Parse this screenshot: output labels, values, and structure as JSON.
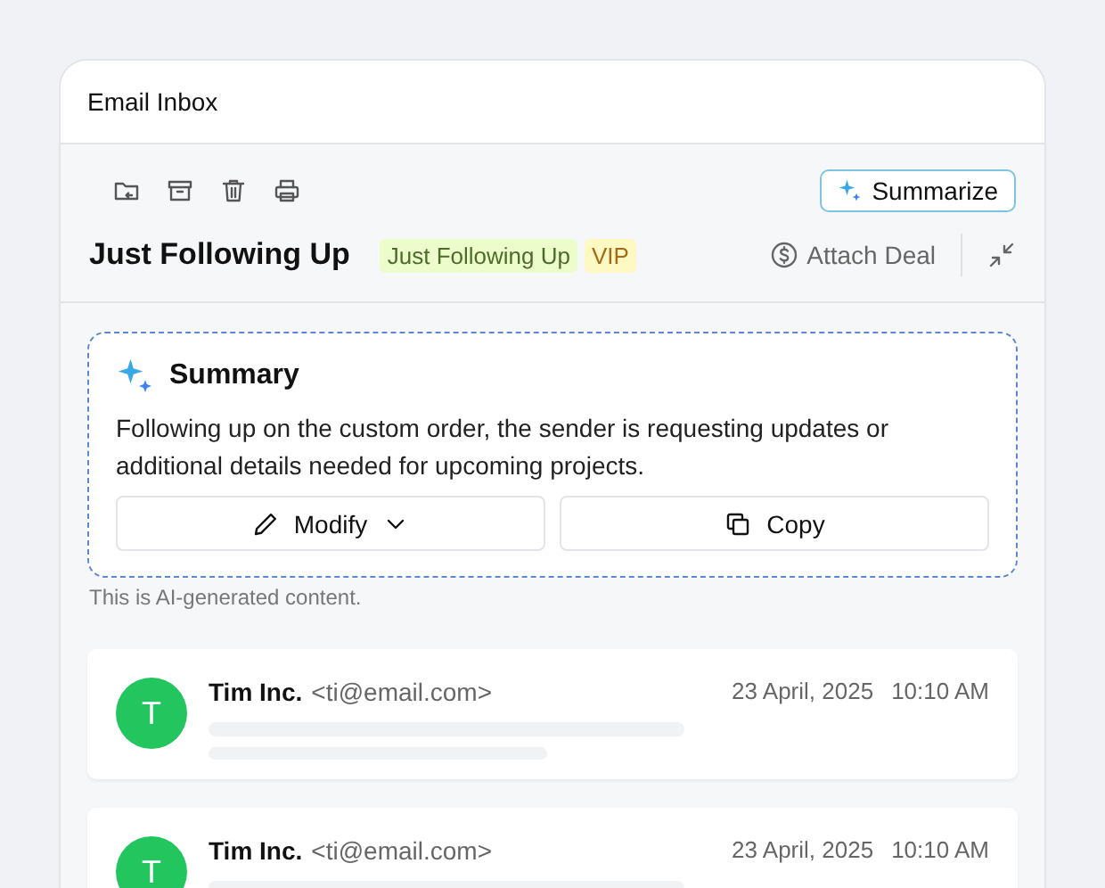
{
  "window": {
    "title": "Email Inbox"
  },
  "toolbar": {
    "summarize_button": "Summarize"
  },
  "subject": {
    "title": "Just Following Up",
    "tags": [
      {
        "label": "Just Following Up",
        "color": "#ecfccb"
      },
      {
        "label": "VIP",
        "color": "#fef9c3"
      }
    ],
    "attach_deal": "Attach Deal"
  },
  "summary": {
    "title": "Summary",
    "text": "Following up on the custom order, the sender is requesting updates or additional details needed for upcoming projects.",
    "buttons": [
      {
        "label": "Modify",
        "kind": "dropdown"
      },
      {
        "label": "Copy",
        "kind": "copy"
      }
    ],
    "note": "This is AI-generated content."
  },
  "emails": [
    {
      "initial": "T",
      "color": "#22c55e",
      "sender": "Tim Inc.",
      "address": "<ti@email.com>",
      "date": "23 April, 2025",
      "time": "10:10 AM"
    },
    {
      "initial": "T",
      "color": "#22c55e",
      "sender": "Tim Inc.",
      "address": "<ti@email.com>",
      "date": "23 April, 2025",
      "time": "10:10 AM"
    }
  ]
}
